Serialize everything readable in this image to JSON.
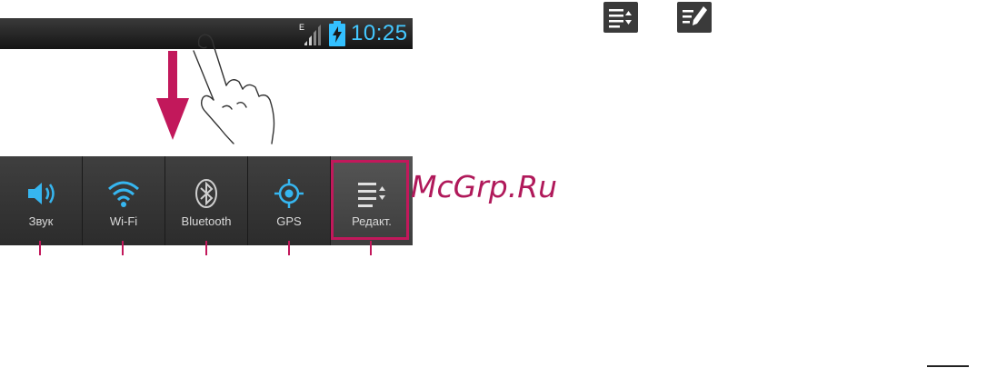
{
  "status_bar": {
    "network_type": "E",
    "time": "10:25"
  },
  "quick_settings": {
    "tiles": [
      {
        "label": "Звук",
        "icon": "volume-icon",
        "selected": false
      },
      {
        "label": "Wi-Fi",
        "icon": "wifi-icon",
        "selected": false
      },
      {
        "label": "Bluetooth",
        "icon": "bluetooth-icon",
        "selected": false
      },
      {
        "label": "GPS",
        "icon": "gps-icon",
        "selected": false
      },
      {
        "label": "Редакт.",
        "icon": "edit-list-icon",
        "selected": true
      }
    ]
  },
  "watermark": "McGrp.Ru",
  "reference_icons": [
    "edit-list-icon",
    "edit-pen-icon"
  ],
  "colors": {
    "accent": "#c2185b",
    "clock": "#44c8ff",
    "icon_blue": "#36b6f0",
    "panel": "#2c2c2c"
  }
}
